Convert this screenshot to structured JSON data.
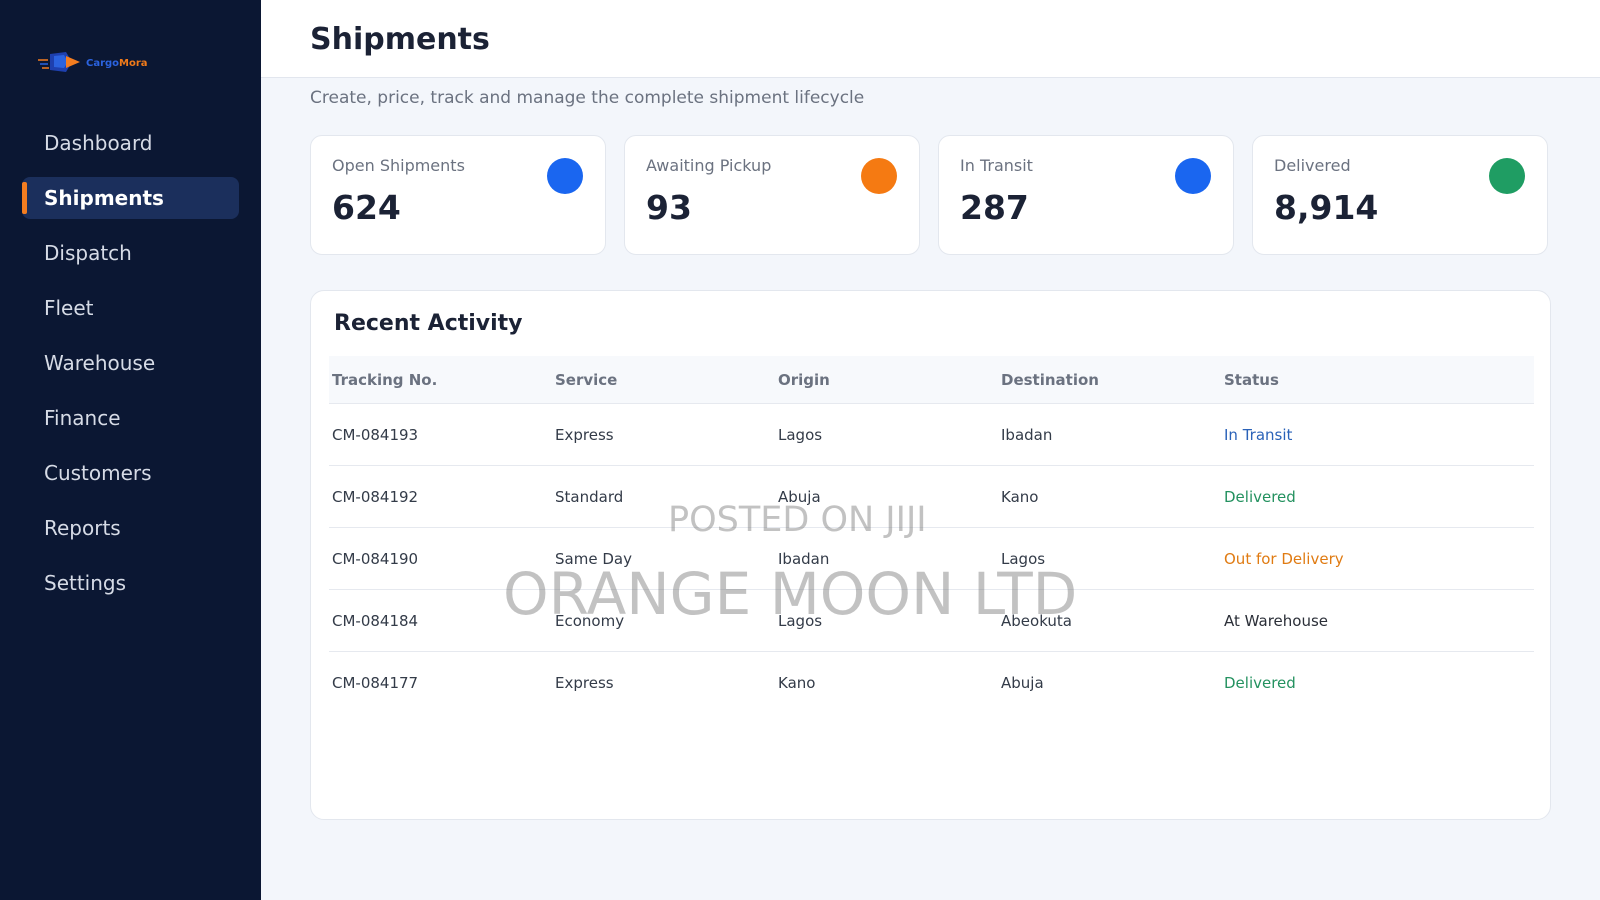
{
  "app": {
    "logo_text_1": "Cargo",
    "logo_text_2": "Mora"
  },
  "sidebar": {
    "items": [
      {
        "label": "Dashboard",
        "active": false
      },
      {
        "label": "Shipments",
        "active": true
      },
      {
        "label": "Dispatch",
        "active": false
      },
      {
        "label": "Fleet",
        "active": false
      },
      {
        "label": "Warehouse",
        "active": false
      },
      {
        "label": "Finance",
        "active": false
      },
      {
        "label": "Customers",
        "active": false
      },
      {
        "label": "Reports",
        "active": false
      },
      {
        "label": "Settings",
        "active": false
      }
    ]
  },
  "header": {
    "title": "Shipments",
    "subtitle": "Create, price, track and manage the complete shipment lifecycle"
  },
  "stats": [
    {
      "label": "Open Shipments",
      "value": "624",
      "color": "#1a66f0"
    },
    {
      "label": "Awaiting Pickup",
      "value": "93",
      "color": "#f57a12"
    },
    {
      "label": "In Transit",
      "value": "287",
      "color": "#1a66f0"
    },
    {
      "label": "Delivered",
      "value": "8,914",
      "color": "#1f9d63"
    }
  ],
  "activity": {
    "title": "Recent Activity",
    "columns": [
      "Tracking No.",
      "Service",
      "Origin",
      "Destination",
      "Status"
    ],
    "rows": [
      {
        "tracking": "CM-084193",
        "service": "Express",
        "origin": "Lagos",
        "destination": "Ibadan",
        "status": "In Transit",
        "status_color": "#2a62b8"
      },
      {
        "tracking": "CM-084192",
        "service": "Standard",
        "origin": "Abuja",
        "destination": "Kano",
        "status": "Delivered",
        "status_color": "#23915f"
      },
      {
        "tracking": "CM-084190",
        "service": "Same Day",
        "origin": "Ibadan",
        "destination": "Lagos",
        "status": "Out for Delivery",
        "status_color": "#e07b12"
      },
      {
        "tracking": "CM-084184",
        "service": "Economy",
        "origin": "Lagos",
        "destination": "Abeokuta",
        "status": "At Warehouse",
        "status_color": "#2b2f38"
      },
      {
        "tracking": "CM-084177",
        "service": "Express",
        "origin": "Kano",
        "destination": "Abuja",
        "status": "Delivered",
        "status_color": "#23915f"
      }
    ]
  },
  "watermark": {
    "line1": "POSTED ON JIJI",
    "line2": "ORANGE MOON LTD"
  }
}
